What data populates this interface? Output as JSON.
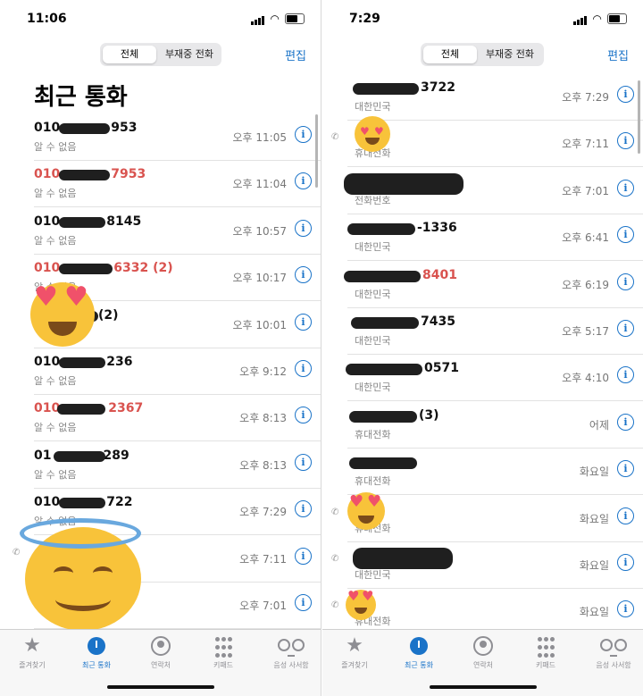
{
  "left": {
    "status_time": "11:06",
    "tabs": [
      "전체",
      "부재중 전화"
    ],
    "edit": "편집",
    "title": "최근 통화",
    "rows": [
      {
        "prefix": "010",
        "suffix": "953",
        "sub": "알 수 없음",
        "time": "오후 11:05",
        "missed": false
      },
      {
        "prefix": "010",
        "suffix": "7953",
        "sub": "알 수 없음",
        "time": "오후 11:04",
        "missed": true
      },
      {
        "prefix": "010",
        "suffix": "8145",
        "sub": "알 수 없음",
        "time": "오후 10:57",
        "missed": false
      },
      {
        "prefix": "010",
        "suffix": "6332 (2)",
        "sub": "알 수 없음",
        "time": "오후 10:17",
        "missed": true
      },
      {
        "prefix": "",
        "suffix": "(2)",
        "sub": "",
        "time": "오후 10:01",
        "missed": false
      },
      {
        "prefix": "010",
        "suffix": "236",
        "sub": "알 수 없음",
        "time": "오후 9:12",
        "missed": false
      },
      {
        "prefix": "010",
        "suffix": "2367",
        "sub": "알 수 없음",
        "time": "오후 8:13",
        "missed": true
      },
      {
        "prefix": "01",
        "suffix": "289",
        "sub": "알 수 없음",
        "time": "오후 8:13",
        "missed": false
      },
      {
        "prefix": "010",
        "suffix": "722",
        "sub": "알 수 없음",
        "time": "오후 7:29",
        "missed": false
      },
      {
        "prefix": "",
        "suffix": "",
        "sub": "",
        "time": "오후 7:11",
        "missed": false
      },
      {
        "prefix": "",
        "suffix": "",
        "sub": "",
        "time": "오후 7:01",
        "missed": false
      }
    ]
  },
  "right": {
    "status_time": "7:29",
    "tabs": [
      "전체",
      "부재중 전화"
    ],
    "edit": "편집",
    "rows": [
      {
        "suffix": "3722",
        "sub": "대한민국",
        "time": "오후 7:29",
        "missed": false
      },
      {
        "suffix": "",
        "sub": "휴대전화",
        "time": "오후 7:11",
        "missed": false
      },
      {
        "suffix": "",
        "sub": "전화번호",
        "time": "오후 7:01",
        "missed": false
      },
      {
        "suffix": "-1336",
        "sub": "대한민국",
        "time": "오후 6:41",
        "missed": false
      },
      {
        "suffix": "8401",
        "sub": "대한민국",
        "time": "오후 6:19",
        "missed": true
      },
      {
        "suffix": "7435",
        "sub": "대한민국",
        "time": "오후 5:17",
        "missed": false
      },
      {
        "suffix": "0571",
        "sub": "대한민국",
        "time": "오후 4:10",
        "missed": false
      },
      {
        "suffix": "(3)",
        "sub": "휴대전화",
        "time": "어제",
        "missed": false
      },
      {
        "suffix": "",
        "sub": "휴대전화",
        "time": "화요일",
        "missed": false
      },
      {
        "suffix": "",
        "sub": "휴대전화",
        "time": "화요일",
        "missed": false
      },
      {
        "suffix": "",
        "sub": "대한민국",
        "time": "화요일",
        "missed": false
      },
      {
        "suffix": "",
        "sub": "휴대전화",
        "time": "화요일",
        "missed": false
      }
    ]
  },
  "tabbar": [
    "즐겨찾기",
    "최근 통화",
    "연락처",
    "키패드",
    "음성 사서함"
  ],
  "info_glyph": "i",
  "colors": {
    "accent": "#1a73c8",
    "missed": "#d9534f"
  }
}
